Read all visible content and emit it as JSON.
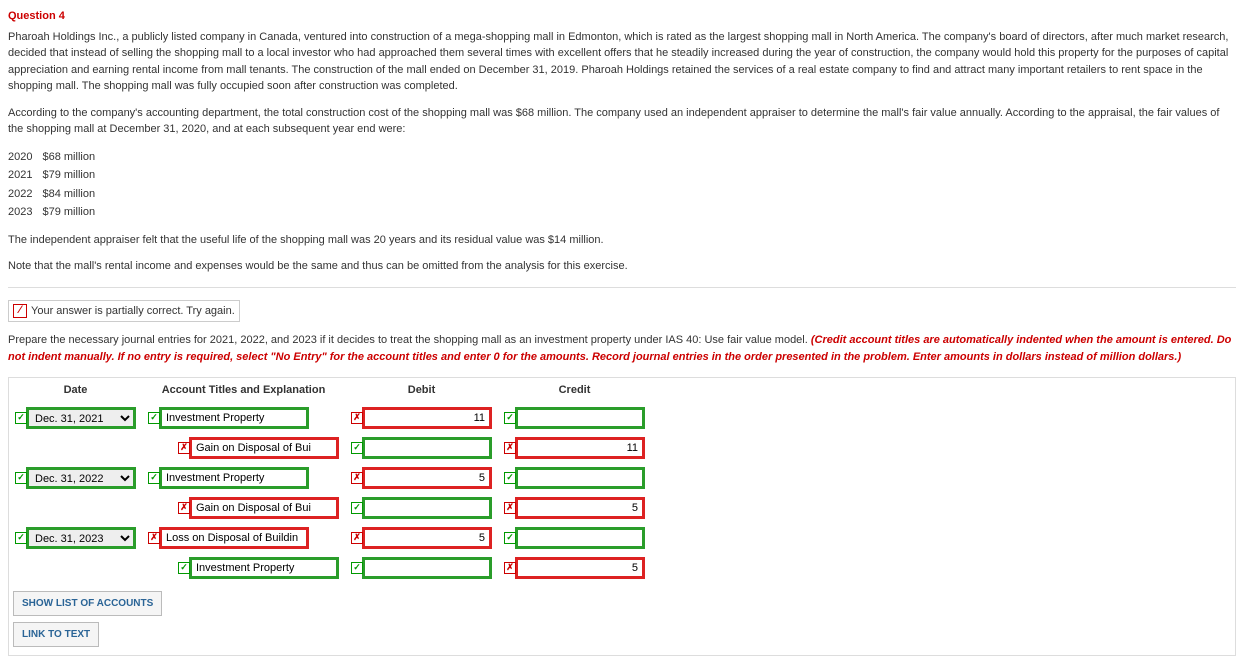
{
  "question": {
    "title": "Question 4",
    "para1": "Pharoah Holdings Inc., a publicly listed company in Canada, ventured into construction of a mega-shopping mall in Edmonton, which is rated as the largest shopping mall in North America. The company's board of directors, after much market research, decided that instead of selling the shopping mall to a local investor who had approached them several times with excellent offers that he steadily increased during the year of construction, the company would hold this property for the purposes of capital appreciation and earning rental income from mall tenants. The construction of the mall ended on December 31, 2019. Pharoah Holdings retained the services of a real estate company to find and attract many important retailers to rent space in the shopping mall. The shopping mall was fully occupied soon after construction was completed.",
    "para2": "According to the company's accounting department, the total construction cost of the shopping mall was $68 million. The company used an independent appraiser to determine the mall's fair value annually. According to the appraisal, the fair values of the shopping mall at December 31, 2020, and at each subsequent year end were:",
    "fv": [
      {
        "year": "2020",
        "amount": "$68 million"
      },
      {
        "year": "2021",
        "amount": "$79 million"
      },
      {
        "year": "2022",
        "amount": "$84 million"
      },
      {
        "year": "2023",
        "amount": "$79 million"
      }
    ],
    "para3": "The independent appraiser felt that the useful life of the shopping mall was 20 years and its residual value was $14 million.",
    "para4": "Note that the mall's rental income and expenses would be the same and thus can be omitted from the analysis for this exercise."
  },
  "feedback": "Your answer is partially correct.  Try again.",
  "instruction": {
    "lead": "Prepare the necessary journal entries for 2021, 2022, and 2023 if it decides to treat the shopping mall as an investment property under IAS 40: Use fair value model. ",
    "italic": "(Credit account titles are automatically indented when the amount is entered. Do not indent manually. If no entry is required, select \"No Entry\" for the account titles and enter 0 for the amounts. Record journal entries in the order presented in the problem. Enter amounts in dollars instead of million dollars.)"
  },
  "headers": {
    "date": "Date",
    "acct": "Account Titles and Explanation",
    "debit": "Debit",
    "credit": "Credit"
  },
  "marks": {
    "check": "✓",
    "cross": "✗",
    "slash": "⁄"
  },
  "rows": [
    {
      "date": {
        "value": "Dec. 31, 2021",
        "mark": "correct"
      },
      "acct": {
        "value": "Investment Property",
        "mark": "correct",
        "indent": false
      },
      "debit": {
        "value": "11",
        "mark": "wrong"
      },
      "credit": {
        "value": "",
        "mark": "correct"
      }
    },
    {
      "date": null,
      "acct": {
        "value": "Gain on Disposal of Bui",
        "mark": "wrong",
        "indent": true
      },
      "debit": {
        "value": "",
        "mark": "correct"
      },
      "credit": {
        "value": "11",
        "mark": "wrong"
      }
    },
    {
      "date": {
        "value": "Dec. 31, 2022",
        "mark": "correct"
      },
      "acct": {
        "value": "Investment Property",
        "mark": "correct",
        "indent": false
      },
      "debit": {
        "value": "5",
        "mark": "wrong"
      },
      "credit": {
        "value": "",
        "mark": "correct"
      }
    },
    {
      "date": null,
      "acct": {
        "value": "Gain on Disposal of Bui",
        "mark": "wrong",
        "indent": true
      },
      "debit": {
        "value": "",
        "mark": "correct"
      },
      "credit": {
        "value": "5",
        "mark": "wrong"
      }
    },
    {
      "date": {
        "value": "Dec. 31, 2023",
        "mark": "correct"
      },
      "acct": {
        "value": "Loss on Disposal of Buildin",
        "mark": "wrong",
        "indent": false
      },
      "debit": {
        "value": "5",
        "mark": "wrong"
      },
      "credit": {
        "value": "",
        "mark": "correct"
      }
    },
    {
      "date": null,
      "acct": {
        "value": "Investment Property",
        "mark": "correct",
        "indent": true
      },
      "debit": {
        "value": "",
        "mark": "correct"
      },
      "credit": {
        "value": "5",
        "mark": "wrong"
      }
    }
  ],
  "buttons": {
    "show": "SHOW LIST OF ACCOUNTS",
    "link": "LINK TO TEXT"
  }
}
